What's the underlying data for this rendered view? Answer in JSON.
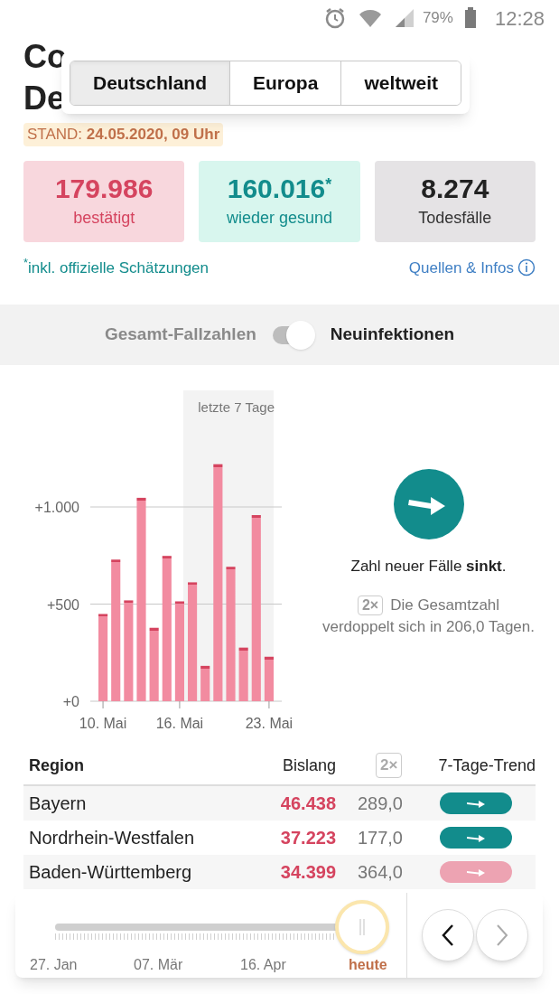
{
  "status_bar": {
    "battery": "79%",
    "time": "12:28"
  },
  "title_lines": [
    "Co",
    "De"
  ],
  "tabs": [
    {
      "label": "Deutschland",
      "selected": true
    },
    {
      "label": "Europa",
      "selected": false
    },
    {
      "label": "weltweit",
      "selected": false
    }
  ],
  "stand": {
    "label": "STAND:",
    "value": "24.05.2020, 09 Uhr"
  },
  "stats": [
    {
      "kind": "confirmed",
      "value": "179.986",
      "label": "bestätigt"
    },
    {
      "kind": "recovered",
      "value": "160.016",
      "mark": "*",
      "label": "wieder gesund"
    },
    {
      "kind": "deaths",
      "value": "8.274",
      "label": "Todesfälle"
    }
  ],
  "footnote": {
    "mark": "*",
    "text": "inkl. offizielle Schätzungen"
  },
  "sources_link": "Quellen & Infos",
  "toggle": {
    "left": "Gesamt-Fallzahlen",
    "right": "Neuinfektionen",
    "on": true
  },
  "chart": {
    "highlight_label": "letzte 7 Tage",
    "chart_data": {
      "type": "bar",
      "categories": [
        "10. Mai",
        null,
        null,
        null,
        null,
        null,
        "16. Mai",
        null,
        null,
        null,
        null,
        null,
        null,
        "23. Mai"
      ],
      "ylim": [
        0,
        1600
      ],
      "series": [
        {
          "color": "#f28ba0",
          "values": [
            449,
            729,
            519,
            1047,
            378,
            748,
            514,
            612,
            182,
            1220,
            692,
            276,
            958,
            229
          ]
        }
      ],
      "yticks": [
        {
          "value": 0,
          "label": "+0"
        },
        {
          "value": 500,
          "label": "+500"
        },
        {
          "value": 1000,
          "label": "+1.000"
        }
      ]
    }
  },
  "trend": {
    "text": "Zahl neuer Fälle **sinkt**.",
    "badge": "2×",
    "doubling": "Die Gesamtzahl verdoppelt sich in 206,0 Tagen."
  },
  "table": {
    "columns": [
      "Region",
      "Bislang",
      "2×",
      "7-Tage-Trend"
    ],
    "rows": [
      {
        "region": "Bayern",
        "total": "46.438",
        "doubling": "289,0",
        "color": "#128c8c"
      },
      {
        "region": "Nordrhein-Westfalen",
        "total": "37.223",
        "doubling": "177,0",
        "color": "#128c8c"
      },
      {
        "region": "Baden-Württemberg",
        "total": "34.399",
        "doubling": "364,0",
        "color": "#eda3b2"
      }
    ]
  },
  "timeline": {
    "level": 1,
    "labels": [
      "27. Jan",
      "07. Mär",
      "16. Apr"
    ],
    "current": "heute"
  }
}
